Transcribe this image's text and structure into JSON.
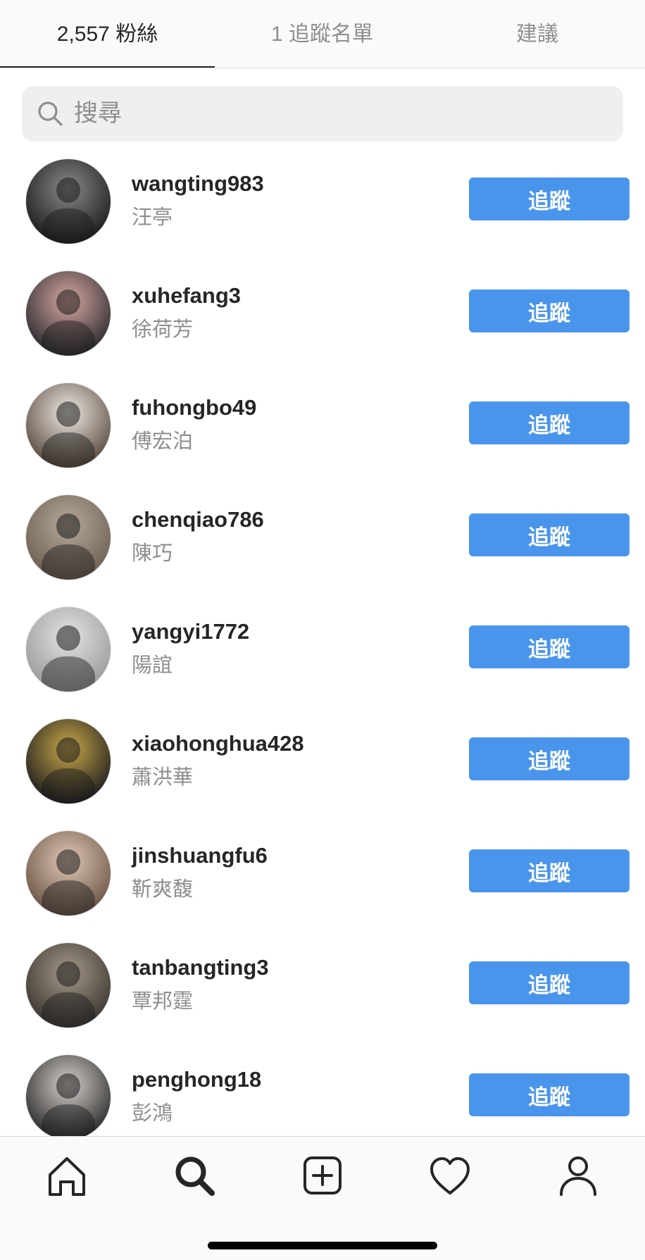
{
  "tabs": [
    {
      "label": "2,557 粉絲",
      "active": true
    },
    {
      "label": "1 追蹤名單",
      "active": false
    },
    {
      "label": "建議",
      "active": false
    }
  ],
  "search": {
    "placeholder": "搜尋",
    "value": ""
  },
  "followers": [
    {
      "username": "wangting983",
      "fullname": "汪亭",
      "button": "追蹤",
      "avatar_colors": [
        "#1b1b1b",
        "#8a8a8a"
      ]
    },
    {
      "username": "xuhefang3",
      "fullname": "徐荷芳",
      "button": "追蹤",
      "avatar_colors": [
        "#2a2a2e",
        "#d9a9a4"
      ]
    },
    {
      "username": "fuhongbo49",
      "fullname": "傅宏泊",
      "button": "追蹤",
      "avatar_colors": [
        "#5b4a3e",
        "#efebe6"
      ]
    },
    {
      "username": "chenqiao786",
      "fullname": "陳巧",
      "button": "追蹤",
      "avatar_colors": [
        "#6d5f52",
        "#b7a99c"
      ]
    },
    {
      "username": "yangyi1772",
      "fullname": "陽誼",
      "button": "追蹤",
      "avatar_colors": [
        "#9a9a9a",
        "#e4e4e2"
      ]
    },
    {
      "username": "xiaohonghua428",
      "fullname": "蕭洪華",
      "button": "追蹤",
      "avatar_colors": [
        "#1c1c1e",
        "#c9a94a"
      ]
    },
    {
      "username": "jinshuangfu6",
      "fullname": "靳爽馥",
      "button": "追蹤",
      "avatar_colors": [
        "#6b5446",
        "#e2c9b6"
      ]
    },
    {
      "username": "tanbangting3",
      "fullname": "覃邦霆",
      "button": "追蹤",
      "avatar_colors": [
        "#3a3530",
        "#a69a8a"
      ]
    },
    {
      "username": "penghong18",
      "fullname": "彭鴻",
      "button": "追蹤",
      "avatar_colors": [
        "#2a2a2a",
        "#d8d2cd"
      ]
    }
  ],
  "nav": [
    {
      "icon": "home-icon"
    },
    {
      "icon": "search-icon",
      "active": true
    },
    {
      "icon": "add-post-icon"
    },
    {
      "icon": "heart-icon"
    },
    {
      "icon": "profile-icon"
    }
  ],
  "colors": {
    "follow_button": "#4a95ec",
    "secondary_text": "#8e8e8e",
    "primary_text": "#262626"
  }
}
